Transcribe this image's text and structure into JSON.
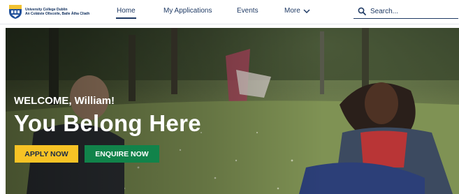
{
  "header": {
    "logo": {
      "line1": "University College Dublin",
      "line2": "An Coláiste Ollscoile, Baile Átha Cliath",
      "icon": "ucd-crest-icon"
    },
    "nav": {
      "home": "Home",
      "applications": "My Applications",
      "events": "Events",
      "more": "More"
    },
    "search": {
      "placeholder": "Search...",
      "icon": "search-icon"
    }
  },
  "hero": {
    "welcome": "WELCOME, William!",
    "tagline": "You Belong Here",
    "apply_label": "APPLY NOW",
    "enquire_label": "ENQUIRE NOW"
  },
  "colors": {
    "navy": "#1f3a64",
    "apply_button": "#f7c325",
    "enquire_button": "#11834a"
  }
}
